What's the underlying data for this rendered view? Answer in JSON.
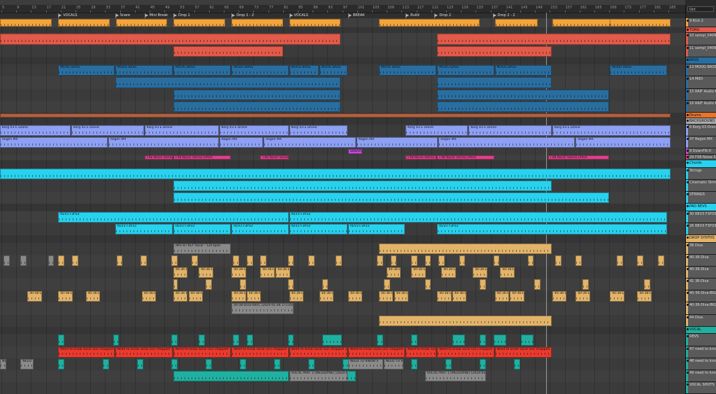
{
  "app": {
    "set_label": "Oct"
  },
  "ruler": {
    "ticks": [
      "5",
      "9",
      "13",
      "17",
      "21",
      "25",
      "29",
      "33",
      "37",
      "41",
      "45",
      "49",
      "53",
      "57",
      "61",
      "65",
      "69",
      "73",
      "77",
      "81",
      "85",
      "89",
      "93",
      "97",
      "101",
      "105",
      "109",
      "113",
      "117",
      "121",
      "125",
      "129",
      "133",
      "137",
      "141",
      "145",
      "149",
      "153",
      "157",
      "161",
      "165",
      "169",
      "173",
      "177",
      "181",
      "185"
    ]
  },
  "locators": [
    {
      "label": "VOCALS",
      "bar": 0.085
    },
    {
      "label": "Snare",
      "bar": 0.168
    },
    {
      "label": "Mini Break",
      "bar": 0.211
    },
    {
      "label": "Drop 1",
      "bar": 0.253
    },
    {
      "label": "Drop 1 - 2",
      "bar": 0.338
    },
    {
      "label": "VOCALS",
      "bar": 0.422
    },
    {
      "label": "BREAK",
      "bar": 0.508
    },
    {
      "label": "Build",
      "bar": 0.592
    },
    {
      "label": "Drop 2",
      "bar": 0.634
    },
    {
      "label": "Drop 2 - 2",
      "bar": 0.719
    }
  ],
  "tracks": [
    {
      "name": "9 Kick 2",
      "color": "#f4a43a",
      "h": 12,
      "type": "midi"
    },
    {
      "name": "TORG",
      "color": "#e25a4a",
      "h": 8,
      "type": "group"
    },
    {
      "name": "10 sampl_0409",
      "color": "#e25a4a",
      "h": 16,
      "type": "midi"
    },
    {
      "name": "11 sampl_0409",
      "color": "#e25a4a",
      "h": 16,
      "type": "midi"
    },
    {
      "name": "BASS",
      "color": "#2a6ea0",
      "h": 10,
      "type": "group"
    },
    {
      "name": "13 MOOG BASS",
      "color": "#2a6ea0",
      "h": 16,
      "type": "midi"
    },
    {
      "name": "14 MIDI",
      "color": "#2a6ea0",
      "h": 16,
      "type": "midi"
    },
    {
      "name": "15 RAIF Audio K",
      "color": "#2a6ea0",
      "h": 16,
      "type": "midi"
    },
    {
      "name": "16 RAIF Audio K",
      "color": "#2a6ea0",
      "h": 16,
      "type": "midi"
    },
    {
      "name": "Drums",
      "color": "#e8732a",
      "h": 8,
      "type": "group"
    },
    {
      "name": "BACKGROUND",
      "color": "#aaaaaa",
      "h": 8,
      "type": "group"
    },
    {
      "name": "6 Korg X3 Drone",
      "color": "#8da0f4",
      "h": 16,
      "type": "midi"
    },
    {
      "name": "37 Regen MX",
      "color": "#8da0f4",
      "h": 16,
      "type": "midi"
    },
    {
      "name": "8 DownFilt-X",
      "color": "#c44ad8",
      "h": 8,
      "type": "midi"
    },
    {
      "name": "29 FX8 Noise St",
      "color": "#e0408a",
      "h": 8,
      "type": "midi"
    },
    {
      "name": "Chords",
      "color": "#28d2ee",
      "h": 10,
      "type": "group"
    },
    {
      "name": "Strings",
      "color": "#28d2ee",
      "h": 16,
      "type": "midi"
    },
    {
      "name": "Cinematic Strin",
      "color": "#28d2ee",
      "h": 16,
      "type": "midi"
    },
    {
      "name": "STRINGS",
      "color": "#28d2ee",
      "h": 16,
      "type": "midi"
    },
    {
      "name": "PAD REVS",
      "color": "#28d2ee",
      "h": 10,
      "type": "group"
    },
    {
      "name": "30 REV3 F3P33",
      "color": "#28d2ee",
      "h": 16,
      "type": "midi"
    },
    {
      "name": "26 REV3 F3P33",
      "color": "#28d2ee",
      "h": 16,
      "type": "midi"
    },
    {
      "name": "DROP SYNTHS",
      "color": "#e2b46a",
      "h": 10,
      "type": "group"
    },
    {
      "name": "36 Diva",
      "color": "#e2b46a",
      "h": 16,
      "type": "midi"
    },
    {
      "name": "40-36-Diva",
      "color": "#e2b46a",
      "h": 16,
      "type": "midi"
    },
    {
      "name": "40-36-Diva",
      "color": "#e2b46a",
      "h": 16,
      "type": "midi"
    },
    {
      "name": "41 36-Diva",
      "color": "#e2b46a",
      "h": 16,
      "type": "midi"
    },
    {
      "name": "40-36-Diva-BIG",
      "color": "#e2b46a",
      "h": 16,
      "type": "midi"
    },
    {
      "name": "40-36-Diva-BIG",
      "color": "#e2b46a",
      "h": 16,
      "type": "midi"
    },
    {
      "name": "44 Diva",
      "color": "#e2b46a",
      "h": 16,
      "type": "midi"
    },
    {
      "name": "VOCAL",
      "color": "#20b0a0",
      "h": 10,
      "type": "group"
    },
    {
      "name": "REVS",
      "color": "#20b0a0",
      "h": 16,
      "type": "midi"
    },
    {
      "name": "47 need to kno",
      "color": "#20b0a0",
      "h": 16,
      "type": "midi"
    },
    {
      "name": "48 need to kno",
      "color": "#20b0a0",
      "h": 16,
      "type": "midi"
    },
    {
      "name": "49 need to kno",
      "color": "#20b0a0",
      "h": 16,
      "type": "midi"
    },
    {
      "name": "VOCAL SHOTS",
      "color": "#20b0a0",
      "h": 16,
      "type": "midi"
    }
  ],
  "clips": [
    {
      "t": 0,
      "color": "#f4a43a",
      "label": "",
      "spans": [
        [
          0,
          0.077
        ],
        [
          0.085,
          0.161
        ],
        [
          0.169,
          0.245
        ],
        [
          0.253,
          0.33
        ],
        [
          0.338,
          0.414
        ],
        [
          0.422,
          0.498
        ],
        [
          0.553,
          0.701
        ],
        [
          0.722,
          0.786
        ],
        [
          0.806,
          0.98
        ],
        [
          0.89,
          0.98
        ]
      ]
    },
    {
      "t": 2,
      "color": "#e25a4a",
      "label": "",
      "spans": [
        [
          0,
          0.498
        ],
        [
          0.638,
          0.98
        ]
      ]
    },
    {
      "t": 3,
      "color": "#e25a4a",
      "label": "",
      "spans": [
        [
          0.253,
          0.414
        ],
        [
          0.638,
          0.806
        ]
      ]
    },
    {
      "t": 5,
      "color": "#2a6ea0",
      "label": "MOOG BASS",
      "spans": [
        [
          0.085,
          0.168
        ],
        [
          0.168,
          0.253
        ],
        [
          0.253,
          0.338
        ],
        [
          0.338,
          0.422
        ],
        [
          0.422,
          0.466
        ],
        [
          0.466,
          0.508
        ],
        [
          0.553,
          0.638
        ],
        [
          0.638,
          0.722
        ],
        [
          0.722,
          0.806
        ],
        [
          0.89,
          0.975
        ]
      ]
    },
    {
      "t": 6,
      "color": "#2a6ea0",
      "label": "",
      "spans": [
        [
          0.168,
          0.498
        ],
        [
          0.638,
          0.806
        ]
      ]
    },
    {
      "t": 7,
      "color": "#2a6ea0",
      "label": "",
      "spans": [
        [
          0.253,
          0.498
        ],
        [
          0.638,
          0.89
        ]
      ]
    },
    {
      "t": 8,
      "color": "#2a6ea0",
      "label": "",
      "spans": [
        [
          0.253,
          0.498
        ],
        [
          0.638,
          0.89
        ]
      ]
    },
    {
      "t": 9,
      "color": "#b06040",
      "label": "",
      "spans": [
        [
          0,
          0.98
        ]
      ]
    },
    {
      "t": 11,
      "color": "#8da0f4",
      "label": "Korg X3 E Drone",
      "spans": [
        [
          0,
          0.104
        ],
        [
          0.104,
          0.211
        ],
        [
          0.211,
          0.32
        ],
        [
          0.32,
          0.422
        ],
        [
          0.422,
          0.508
        ],
        [
          0.592,
          0.684
        ],
        [
          0.684,
          0.806
        ],
        [
          0.806,
          0.98
        ]
      ]
    },
    {
      "t": 12,
      "color": "#8da0f4",
      "label": "Regen MX",
      "spans": [
        [
          0,
          0.158
        ],
        [
          0.158,
          0.32
        ],
        [
          0.32,
          0.385
        ],
        [
          0.385,
          0.52
        ],
        [
          0.52,
          0.64
        ],
        [
          0.64,
          0.84
        ],
        [
          0.84,
          0.98
        ]
      ]
    },
    {
      "t": 13,
      "color": "#c44ad8",
      "label": "DownFilt",
      "spans": [
        [
          0.508,
          0.53
        ]
      ]
    },
    {
      "t": 14,
      "color": "#e0408a",
      "label": "FX8 Noise Stereo Effect",
      "spans": [
        [
          0.211,
          0.253
        ],
        [
          0.253,
          0.338
        ],
        [
          0.38,
          0.422
        ],
        [
          0.592,
          0.638
        ],
        [
          0.638,
          0.722
        ],
        [
          0.8,
          0.89
        ]
      ]
    },
    {
      "t": 16,
      "color": "#28d2ee",
      "label": "",
      "spans": [
        [
          0,
          0.98
        ]
      ]
    },
    {
      "t": 17,
      "color": "#28d2ee",
      "label": "",
      "spans": [
        [
          0.253,
          0.806
        ]
      ]
    },
    {
      "t": 18,
      "color": "#28d2ee",
      "label": "",
      "spans": [
        [
          0.253,
          0.89
        ]
      ]
    },
    {
      "t": 20,
      "color": "#28d2ee",
      "label": "REV3 F3P33",
      "spans": [
        [
          0.085,
          0.422
        ],
        [
          0.422,
          0.975
        ]
      ]
    },
    {
      "t": 21,
      "color": "#28d2ee",
      "label": "REV3 F3P33",
      "spans": [
        [
          0.168,
          0.253
        ],
        [
          0.253,
          0.338
        ],
        [
          0.338,
          0.422
        ],
        [
          0.422,
          0.508
        ],
        [
          0.508,
          0.592
        ],
        [
          0.638,
          0.975
        ]
      ]
    },
    {
      "t": 23,
      "color": "#e2b46a",
      "label": "",
      "spans": [
        [
          0.553,
          0.806
        ]
      ]
    },
    {
      "t": 23,
      "color": "#8a8a8a",
      "label": "AKS-97 KEY Vocal - 124 bpm",
      "spans": [
        [
          0.253,
          0.338
        ]
      ]
    },
    {
      "t": 24,
      "color": "#e2b46a",
      "label": "",
      "spans": [
        [
          0.085,
          0.095
        ],
        [
          0.105,
          0.115
        ],
        [
          0.17,
          0.18
        ],
        [
          0.205,
          0.215
        ],
        [
          0.25,
          0.26
        ],
        [
          0.28,
          0.29
        ],
        [
          0.34,
          0.35
        ],
        [
          0.36,
          0.37
        ],
        [
          0.38,
          0.39
        ],
        [
          0.42,
          0.43
        ],
        [
          0.45,
          0.46
        ],
        [
          0.49,
          0.5
        ],
        [
          0.55,
          0.56
        ],
        [
          0.57,
          0.58
        ],
        [
          0.6,
          0.61
        ],
        [
          0.62,
          0.63
        ],
        [
          0.64,
          0.65
        ],
        [
          0.67,
          0.68
        ],
        [
          0.72,
          0.73
        ],
        [
          0.77,
          0.78
        ],
        [
          0.81,
          0.82
        ],
        [
          0.84,
          0.85
        ],
        [
          0.9,
          0.91
        ],
        [
          0.93,
          0.94
        ],
        [
          0.96,
          0.97
        ]
      ]
    },
    {
      "t": 24,
      "color": "#8a8a8a",
      "label": "",
      "spans": [
        [
          0.005,
          0.015
        ],
        [
          0.03,
          0.04
        ],
        [
          0.07,
          0.08
        ]
      ]
    },
    {
      "t": 25,
      "color": "#e2b46a",
      "label": "40-36-Diva",
      "spans": [
        [
          0.253,
          0.275
        ],
        [
          0.29,
          0.312
        ],
        [
          0.338,
          0.36
        ],
        [
          0.38,
          0.402
        ],
        [
          0.402,
          0.424
        ],
        [
          0.564,
          0.586
        ],
        [
          0.6,
          0.622
        ],
        [
          0.644,
          0.666
        ],
        [
          0.69,
          0.712
        ],
        [
          0.73,
          0.752
        ]
      ]
    },
    {
      "t": 26,
      "color": "#e2b46a",
      "label": "",
      "spans": [
        [
          0.253,
          0.26
        ],
        [
          0.3,
          0.31
        ],
        [
          0.35,
          0.36
        ],
        [
          0.42,
          0.43
        ],
        [
          0.47,
          0.48
        ],
        [
          0.56,
          0.57
        ],
        [
          0.62,
          0.63
        ],
        [
          0.7,
          0.71
        ],
        [
          0.78,
          0.79
        ],
        [
          0.85,
          0.86
        ],
        [
          0.94,
          0.95
        ]
      ]
    },
    {
      "t": 27,
      "color": "#e2b46a",
      "label": "40-36-Diva",
      "spans": [
        [
          0.04,
          0.062
        ],
        [
          0.085,
          0.107
        ],
        [
          0.125,
          0.147
        ],
        [
          0.207,
          0.229
        ],
        [
          0.253,
          0.275
        ],
        [
          0.275,
          0.297
        ],
        [
          0.338,
          0.36
        ],
        [
          0.36,
          0.382
        ],
        [
          0.422,
          0.444
        ],
        [
          0.466,
          0.488
        ],
        [
          0.508,
          0.53
        ],
        [
          0.553,
          0.575
        ],
        [
          0.575,
          0.597
        ],
        [
          0.638,
          0.66
        ],
        [
          0.66,
          0.682
        ],
        [
          0.722,
          0.744
        ],
        [
          0.744,
          0.766
        ],
        [
          0.806,
          0.828
        ],
        [
          0.84,
          0.862
        ],
        [
          0.89,
          0.912
        ],
        [
          0.93,
          0.952
        ]
      ]
    },
    {
      "t": 28,
      "color": "#8a8a8a",
      "label": "40-36-Diva-0001 [2024-01-06 171358]",
      "spans": [
        [
          0.338,
          0.43
        ]
      ]
    },
    {
      "t": 29,
      "color": "#e2b46a",
      "label": "",
      "spans": [
        [
          0.553,
          0.806
        ]
      ]
    },
    {
      "t": 31,
      "color": "#20b0a0",
      "label": "",
      "spans": [
        [
          0.085,
          0.095
        ],
        [
          0.165,
          0.175
        ],
        [
          0.25,
          0.26
        ],
        [
          0.29,
          0.3
        ],
        [
          0.34,
          0.35
        ],
        [
          0.36,
          0.37
        ],
        [
          0.42,
          0.43
        ],
        [
          0.47,
          0.5
        ],
        [
          0.55,
          0.56
        ],
        [
          0.6,
          0.61
        ],
        [
          0.66,
          0.68
        ],
        [
          0.7,
          0.71
        ],
        [
          0.72,
          0.74
        ],
        [
          0.76,
          0.78
        ]
      ]
    },
    {
      "t": 32,
      "color": "#ea3a2e",
      "label": "Need to know vocal (ov) chopped 1 (Freeze)",
      "spans": [
        [
          0.085,
          0.168
        ],
        [
          0.168,
          0.253
        ],
        [
          0.253,
          0.338
        ],
        [
          0.338,
          0.422
        ],
        [
          0.422,
          0.508
        ],
        [
          0.508,
          0.592
        ],
        [
          0.592,
          0.638
        ],
        [
          0.638,
          0.722
        ],
        [
          0.722,
          0.806
        ]
      ]
    },
    {
      "t": 33,
      "color": "#20b0a0",
      "label": "",
      "spans": [
        [
          0.04,
          0.05
        ],
        [
          0.085,
          0.095
        ],
        [
          0.15,
          0.16
        ],
        [
          0.2,
          0.21
        ],
        [
          0.25,
          0.26
        ],
        [
          0.3,
          0.31
        ],
        [
          0.35,
          0.36
        ],
        [
          0.4,
          0.41
        ],
        [
          0.45,
          0.46
        ],
        [
          0.5,
          0.51
        ],
        [
          0.56,
          0.57
        ],
        [
          0.6,
          0.61
        ],
        [
          0.65,
          0.66
        ],
        [
          0.7,
          0.71
        ],
        [
          0.75,
          0.76
        ]
      ]
    },
    {
      "t": 33,
      "color": "#8a8a8a",
      "label": "NEED TO KNOW V",
      "spans": [
        [
          0.508,
          0.56
        ],
        [
          0.56,
          0.59
        ],
        [
          0.03,
          0.05
        ],
        [
          0.0,
          0.01
        ]
      ]
    },
    {
      "t": 34,
      "color": "#20b0a0",
      "label": "",
      "spans": [
        [
          0.253,
          0.422
        ],
        [
          0.47,
          0.52
        ]
      ]
    },
    {
      "t": 34,
      "color": "#8a8a8a",
      "label": "VOCAL PART 1 (MELODYNE) (2024-01-16)",
      "spans": [
        [
          0.422,
          0.508
        ],
        [
          0.62,
          0.71
        ]
      ]
    }
  ]
}
